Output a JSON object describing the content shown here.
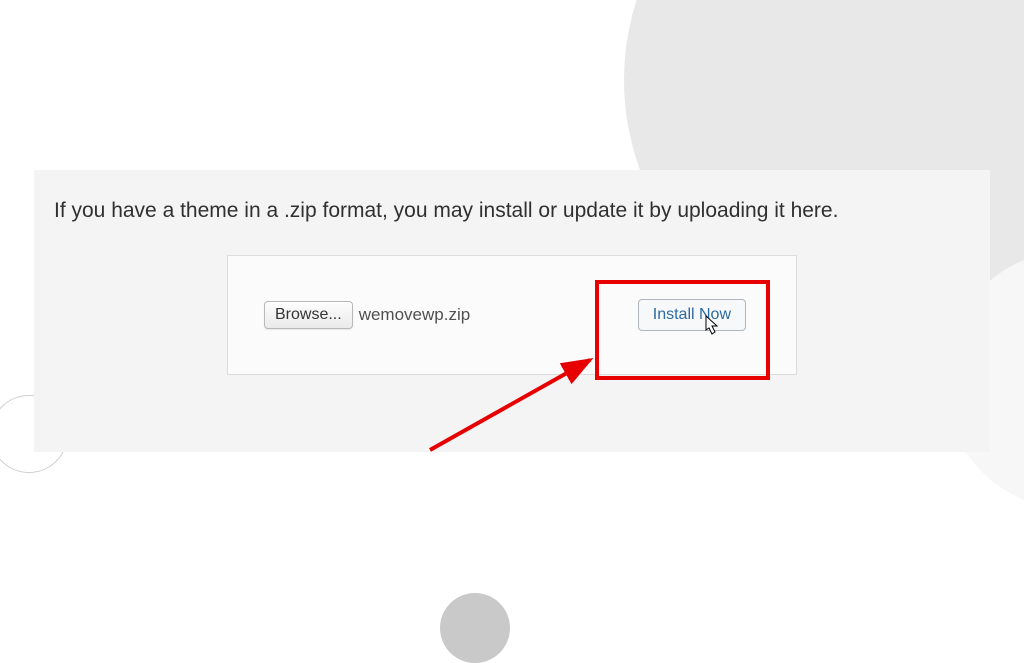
{
  "panel": {
    "instruction": "If you have a theme in a .zip format, you may install or update it by uploading it here.",
    "browse_label": "Browse...",
    "selected_file": "wemovewp.zip",
    "install_label": "Install Now"
  }
}
